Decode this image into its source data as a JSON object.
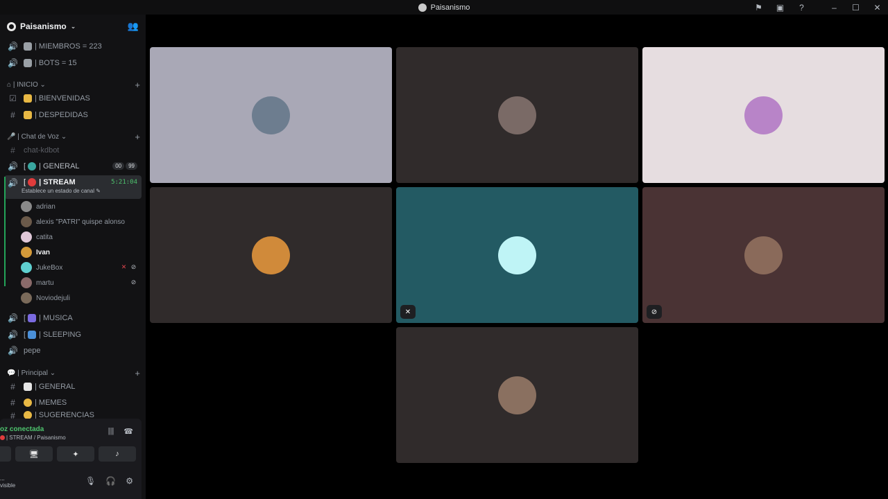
{
  "window": {
    "title": "Paisanismo"
  },
  "server": {
    "name": "Paisanismo"
  },
  "channels_top": [
    {
      "label": "| MIEMBROS = 223"
    },
    {
      "label": "| BOTS = 15"
    }
  ],
  "categories": {
    "inicio": "| INICIO",
    "voz": "| Chat de Voz",
    "principal": "| Principal"
  },
  "inicio_channels": [
    {
      "label": "| BIENVENIDAS"
    },
    {
      "label": "| DESPEDIDAS"
    }
  ],
  "voice_channels": {
    "chat_kdbot": "chat-kdbot",
    "general": "| GENERAL",
    "general_badges": [
      "00",
      "99"
    ],
    "stream": "| STREAM",
    "stream_timer": "5:21:04",
    "stream_status": "Establece un estado de canal",
    "musica": "| MUSICA",
    "sleeping": "| SLEEPING",
    "pepe": "pepe"
  },
  "members": [
    {
      "name": "adrian",
      "color": "#8a8a8a"
    },
    {
      "name": "alexis \"PATRI\" quispe alonso",
      "color": "#6b5a4a"
    },
    {
      "name": "catita",
      "color": "#e0c8d8"
    },
    {
      "name": "Ivan",
      "color": "#d49a3a"
    },
    {
      "name": "JukeBox",
      "color": "#5fd0d0"
    },
    {
      "name": "martu",
      "color": "#8a6a6a"
    },
    {
      "name": "Noviodejuli",
      "color": "#7a6a5a"
    }
  ],
  "principal_channels": [
    {
      "label": "| GENERAL"
    },
    {
      "label": "| MEMES"
    },
    {
      "label": "| SUGERENCIAS"
    }
  ],
  "user_panel": {
    "voice_status": "oz conectada",
    "voice_location": "| STREAM / Paisanismo",
    "user_dots": "...",
    "user_status": "visible"
  },
  "tiles": [
    {
      "bg": "#a9a8b6",
      "avatar_color": "#6d7d8f"
    },
    {
      "bg": "#302b2b",
      "avatar_color": "#7a6a66"
    },
    {
      "bg": "#e6dde0",
      "avatar_color": "#b884c8"
    },
    {
      "bg": "#302b2b",
      "avatar_color": "#d08a3a"
    },
    {
      "bg": "#235a63",
      "avatar_color": "#bff4f6"
    },
    {
      "bg": "#4a3334",
      "avatar_color": "#8a6a5a"
    },
    {
      "bg": "#302b2b",
      "avatar_color": "#8a7060"
    }
  ]
}
